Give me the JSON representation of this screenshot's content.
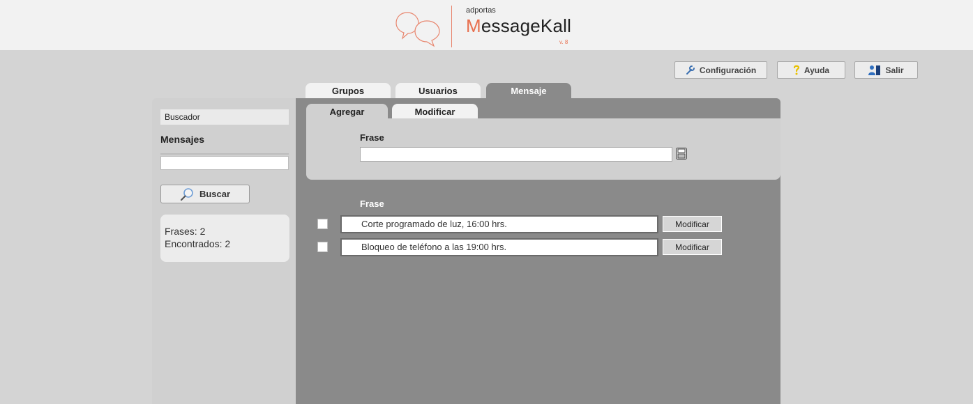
{
  "brand": {
    "small": "adportas",
    "initial": "M",
    "rest": "essageKall",
    "version": "v. 8",
    "accent_color": "#e8704f"
  },
  "topbar": {
    "config_label": "Configuración",
    "help_label": "Ayuda",
    "exit_label": "Salir",
    "config_icon": "wrench-icon",
    "help_icon": "question-icon",
    "exit_icon": "users-exit-icon"
  },
  "tabs": [
    {
      "label": "Grupos",
      "active": false
    },
    {
      "label": "Usuarios",
      "active": false
    },
    {
      "label": "Mensaje",
      "active": true
    }
  ],
  "sidebar": {
    "heading": "Buscador",
    "title": "Mensajes",
    "search_value": "",
    "search_button": "Buscar",
    "stats": {
      "frases": "Frases: 2",
      "encontrados": "Encontrados: 2"
    }
  },
  "subtabs": [
    {
      "label": "Agregar",
      "active": true
    },
    {
      "label": "Modificar",
      "active": false
    }
  ],
  "add_panel": {
    "label": "Frase",
    "input_value": ""
  },
  "list": {
    "header": "Frase",
    "rows": [
      {
        "text": "Corte programado de luz, 16:00 hrs.",
        "button": "Modificar",
        "checked": false
      },
      {
        "text": "Bloqueo de teléfono a las 19:00 hrs.",
        "button": "Modificar",
        "checked": false
      }
    ]
  },
  "colors": {
    "page_bg": "#d4d4d4",
    "panel_bg": "#8a8a8a",
    "header_bg": "#f2f2f2"
  }
}
